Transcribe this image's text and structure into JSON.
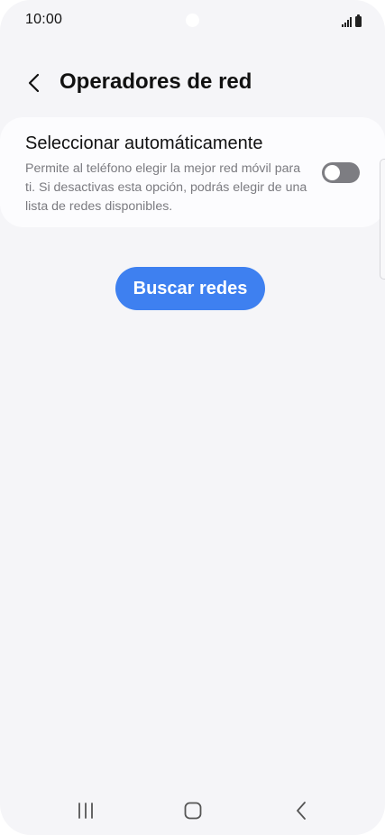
{
  "status_bar": {
    "time": "10:00",
    "icons": [
      "signal-icon",
      "battery-icon"
    ]
  },
  "header": {
    "back_icon": "chevron-left-icon",
    "title": "Operadores de red"
  },
  "auto_select": {
    "title": "Seleccionar automáticamente",
    "description": "Permite al teléfono elegir la mejor red móvil para ti. Si desactivas esta opción, podrás elegir de una lista de redes disponibles.",
    "toggle_on": false
  },
  "search_button": {
    "label": "Buscar redes"
  },
  "nav_bar": {
    "icons": [
      "recent-apps-icon",
      "home-icon",
      "back-icon"
    ]
  },
  "colors": {
    "background": "#f5f5f8",
    "card": "#fcfcfe",
    "accent": "#3e80f0",
    "toggle_off": "#7d7d82",
    "text_primary": "#111111",
    "text_secondary": "#7b7b80"
  }
}
